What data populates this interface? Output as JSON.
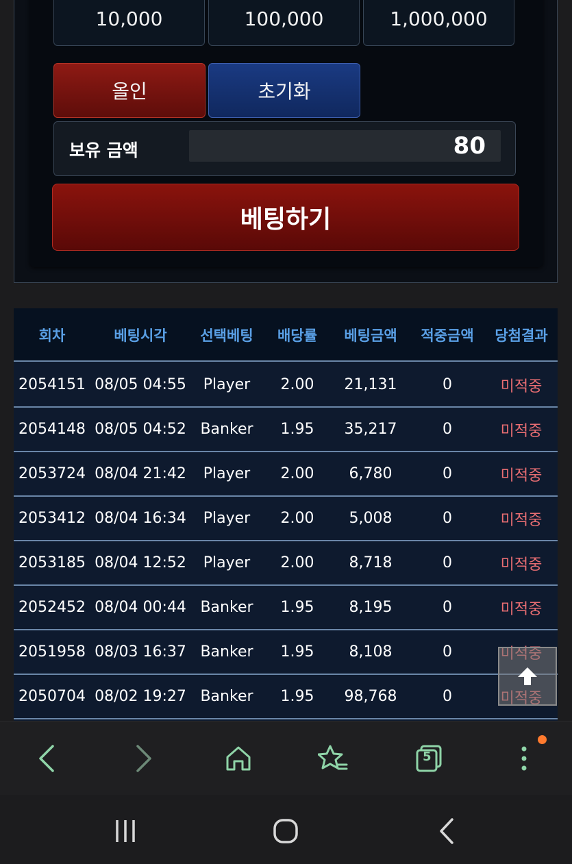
{
  "chips": [
    "10,000",
    "100,000",
    "1,000,000"
  ],
  "buttons": {
    "allin": "올인",
    "reset": "초기화",
    "bet": "베팅하기"
  },
  "balance": {
    "label": "보유 금액",
    "value": "80"
  },
  "table": {
    "headers": [
      "회차",
      "베팅시각",
      "선택베팅",
      "배당률",
      "베팅금액",
      "적중금액",
      "당첨결과"
    ],
    "rows": [
      [
        "2054151",
        "08/05 04:55",
        "Player",
        "2.00",
        "21,131",
        "0",
        "미적중"
      ],
      [
        "2054148",
        "08/05 04:52",
        "Banker",
        "1.95",
        "35,217",
        "0",
        "미적중"
      ],
      [
        "2053724",
        "08/04 21:42",
        "Player",
        "2.00",
        "6,780",
        "0",
        "미적중"
      ],
      [
        "2053412",
        "08/04 16:34",
        "Player",
        "2.00",
        "5,008",
        "0",
        "미적중"
      ],
      [
        "2053185",
        "08/04 12:52",
        "Player",
        "2.00",
        "8,718",
        "0",
        "미적중"
      ],
      [
        "2052452",
        "08/04 00:44",
        "Banker",
        "1.95",
        "8,195",
        "0",
        "미적중"
      ],
      [
        "2051958",
        "08/03 16:37",
        "Banker",
        "1.95",
        "8,108",
        "0",
        "미적중"
      ],
      [
        "2050704",
        "08/02 19:27",
        "Banker",
        "1.95",
        "98,768",
        "0",
        "미적중"
      ]
    ]
  },
  "browser": {
    "tab_count": "5"
  },
  "colors": {
    "accent_red": "#8e1a14",
    "accent_blue": "#1a3a82",
    "header_text": "#5aa0e6",
    "result_text": "#e86d72",
    "browser_icon": "#8fd4a8"
  },
  "icons": {
    "browser": [
      "back-icon",
      "forward-icon",
      "home-icon",
      "bookmark-star-icon",
      "tabs-icon",
      "more-vertical-icon"
    ],
    "system": [
      "recent-apps-icon",
      "home-circle-icon",
      "system-back-icon"
    ],
    "scroll": "arrow-up-icon"
  }
}
